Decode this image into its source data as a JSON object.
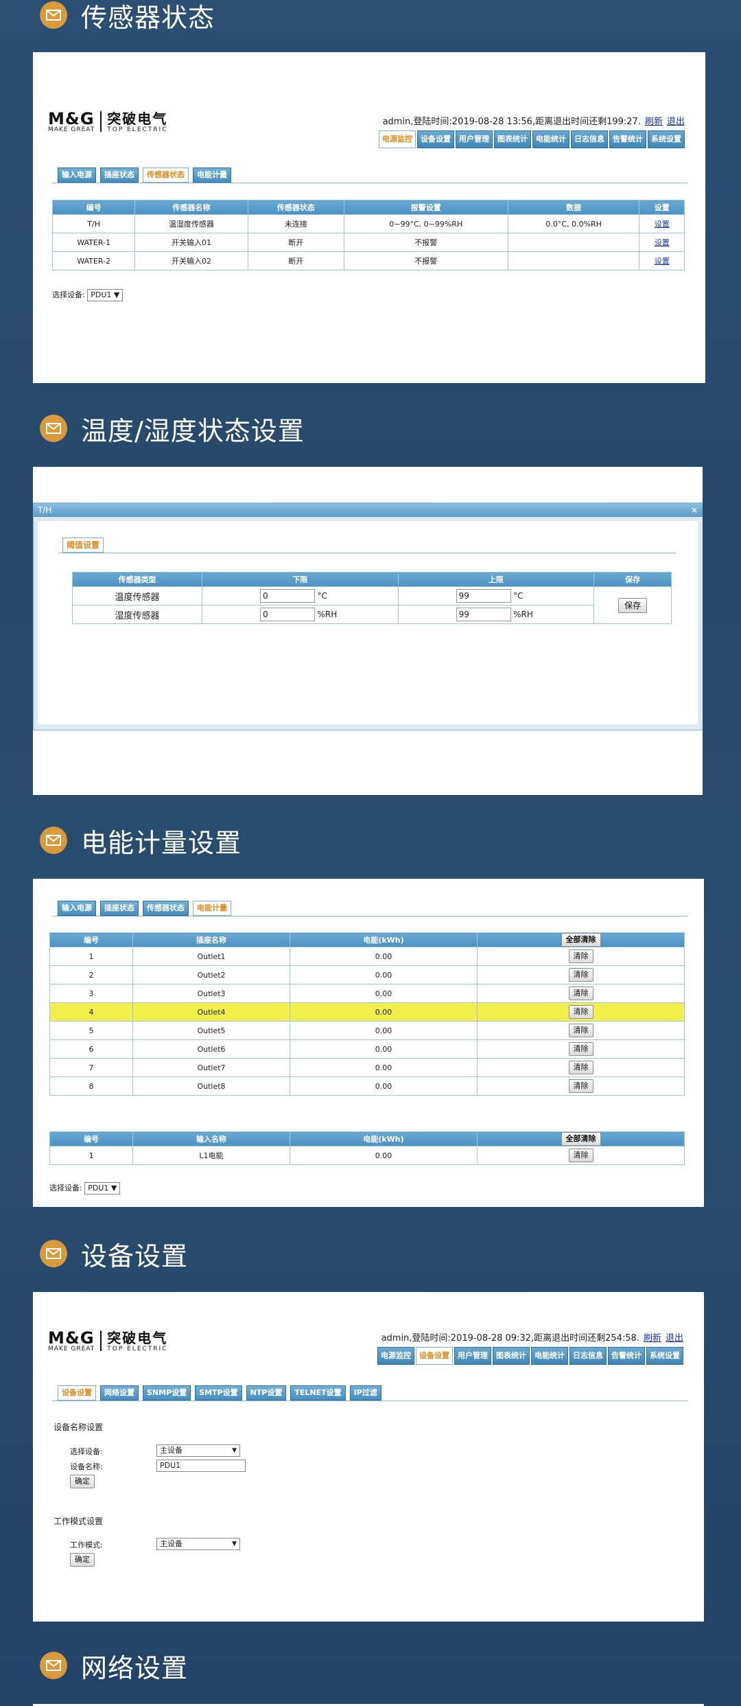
{
  "sections": {
    "s1": {
      "title": "传感器状态"
    },
    "s2": {
      "title": "温度/湿度状态设置"
    },
    "s3": {
      "title": "电能计量设置"
    },
    "s4": {
      "title": "设备设置"
    },
    "s5": {
      "title": "网络设置"
    }
  },
  "brand": {
    "mg": "M&G",
    "mg_sub": "MAKE GREAT",
    "cn": "突破电气",
    "cn_sub": "TOP ELECTRIC"
  },
  "nav": [
    "电源监控",
    "设备设置",
    "用户管理",
    "图表统计",
    "电能统计",
    "日志信息",
    "告警统计",
    "系统设置"
  ],
  "subtabs": [
    "输入电源",
    "插座状态",
    "传感器状态",
    "电能计量"
  ],
  "common": {
    "select_device_label": "选择设备:",
    "pdu": "PDU1 ▼",
    "set_link": "设置",
    "clear": "清除",
    "clear_all": "全部清除",
    "refresh": "刷新",
    "logout": "退出"
  },
  "panel1": {
    "admin_text": "admin,登陆时间:2019-08-28 13:56,距离退出时间还剩199:27.",
    "headers": [
      "编号",
      "传感器名称",
      "传感器状态",
      "报警设置",
      "数据",
      "设置"
    ],
    "rows": [
      [
        "T/H",
        "温湿度传感器",
        "未连接",
        "0~99°C, 0~99%RH",
        "0.0°C, 0.0%RH"
      ],
      [
        "WATER-1",
        "开关输入01",
        "断开",
        "不报警",
        ""
      ],
      [
        "WATER-2",
        "开关输入02",
        "断开",
        "不报警",
        ""
      ]
    ]
  },
  "panel2": {
    "window_title": "T/H",
    "close": "×",
    "tab": "阈值设置",
    "headers": [
      "传感器类型",
      "下限",
      "上限",
      "保存"
    ],
    "rows": [
      {
        "type": "温度传感器",
        "low": "0",
        "low_unit": "°C",
        "high": "99",
        "high_unit": "°C"
      },
      {
        "type": "湿度传感器",
        "low": "0",
        "low_unit": "%RH",
        "high": "99",
        "high_unit": "%RH"
      }
    ],
    "save": "保存"
  },
  "panel3": {
    "headers": [
      "编号",
      "插座名称",
      "电能(kWh)"
    ],
    "rows": [
      [
        "1",
        "Outlet1",
        "0.00"
      ],
      [
        "2",
        "Outlet2",
        "0.00"
      ],
      [
        "3",
        "Outlet3",
        "0.00"
      ],
      [
        "4",
        "Outlet4",
        "0.00"
      ],
      [
        "5",
        "Outlet5",
        "0.00"
      ],
      [
        "6",
        "Outlet6",
        "0.00"
      ],
      [
        "7",
        "Outlet7",
        "0.00"
      ],
      [
        "8",
        "Outlet8",
        "0.00"
      ]
    ],
    "highlight_row": 4,
    "headers2": [
      "编号",
      "输入名称",
      "电能(kWh)"
    ],
    "rows2": [
      [
        "1",
        "L1电能",
        "0.00"
      ]
    ]
  },
  "panel4": {
    "admin_text": "admin,登陆时间:2019-08-28 09:32,距离退出时间还剩254:58.",
    "subtabs": [
      "设备设置",
      "网络设置",
      "SNMP设置",
      "SMTP设置",
      "NTP设置",
      "TELNET设置",
      "IP过滤"
    ],
    "name_section": "设备名称设置",
    "select_device": "选择设备:",
    "select_value": "主设备",
    "device_name_label": "设备名称:",
    "device_name_value": "PDU1",
    "confirm": "确定",
    "mode_section": "工作模式设置",
    "mode_label": "工作模式:",
    "mode_value": "主设备"
  }
}
